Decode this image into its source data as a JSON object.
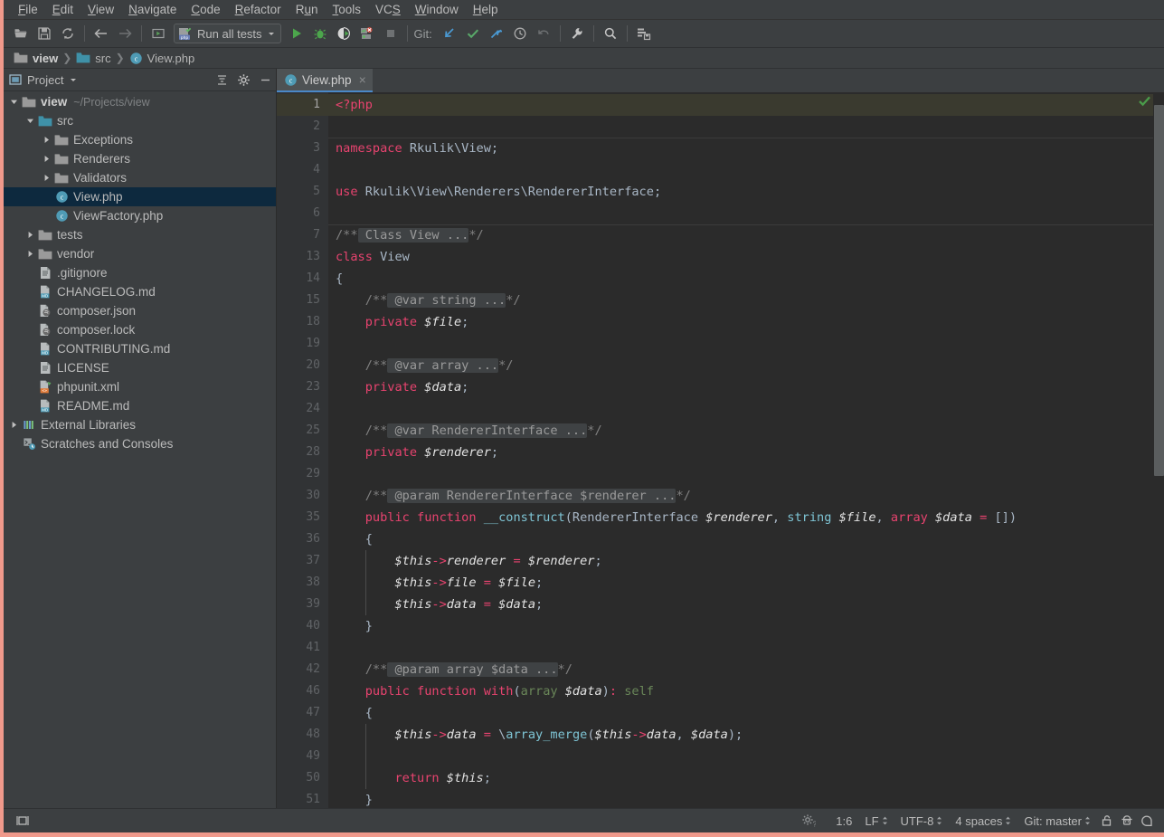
{
  "menubar": {
    "items": [
      {
        "label": "File",
        "mnemonic": "F"
      },
      {
        "label": "Edit",
        "mnemonic": "E"
      },
      {
        "label": "View",
        "mnemonic": "V"
      },
      {
        "label": "Navigate",
        "mnemonic": "N"
      },
      {
        "label": "Code",
        "mnemonic": "C"
      },
      {
        "label": "Refactor",
        "mnemonic": "R"
      },
      {
        "label": "Run",
        "mnemonic": "u"
      },
      {
        "label": "Tools",
        "mnemonic": "T"
      },
      {
        "label": "VCS",
        "mnemonic": "S"
      },
      {
        "label": "Window",
        "mnemonic": "W"
      },
      {
        "label": "Help",
        "mnemonic": "H"
      }
    ]
  },
  "toolbar": {
    "icons_left": [
      "open-folder-icon",
      "save-all-icon",
      "sync-icon"
    ],
    "nav_icons": [
      "back-icon",
      "forward-icon"
    ],
    "run_config": {
      "icon": "php-test-icon",
      "label": "Run all tests",
      "dropdown": "chevron-down-icon"
    },
    "run_icons": [
      "run-icon",
      "debug-icon",
      "run-with-coverage-icon",
      "profile-icon",
      "stop-icon"
    ],
    "git_label": "Git:",
    "git_icons": [
      "update-project-icon",
      "commit-icon",
      "push-icon",
      "history-icon",
      "rollback-icon"
    ],
    "right_icons": [
      "wrench-icon",
      "search-icon",
      "layout-icon"
    ]
  },
  "breadcrumb": {
    "items": [
      {
        "label": "view",
        "icon": "folder-icon"
      },
      {
        "label": "src",
        "icon": "folder-blue-icon"
      },
      {
        "label": "View.php",
        "icon": "php-class-icon"
      }
    ],
    "separator": "❯"
  },
  "project_panel": {
    "title": "Project",
    "dropdown_icon": "chevron-down-icon",
    "header_icons": [
      "collapse-all-icon",
      "gear-icon",
      "hide-icon"
    ],
    "tree": [
      {
        "label": "view",
        "path": "~/Projects/view",
        "icon": "folder-icon",
        "arrow": "down",
        "indent": 0,
        "bold": true,
        "selected": false
      },
      {
        "label": "src",
        "path": "",
        "icon": "folder-blue-icon",
        "arrow": "down",
        "indent": 1,
        "bold": false,
        "selected": false
      },
      {
        "label": "Exceptions",
        "path": "",
        "icon": "folder-icon",
        "arrow": "right",
        "indent": 2,
        "bold": false,
        "selected": false
      },
      {
        "label": "Renderers",
        "path": "",
        "icon": "folder-icon",
        "arrow": "right",
        "indent": 2,
        "bold": false,
        "selected": false
      },
      {
        "label": "Validators",
        "path": "",
        "icon": "folder-icon",
        "arrow": "right",
        "indent": 2,
        "bold": false,
        "selected": false
      },
      {
        "label": "View.php",
        "path": "",
        "icon": "php-class-icon",
        "arrow": "none",
        "indent": 2,
        "bold": false,
        "selected": true
      },
      {
        "label": "ViewFactory.php",
        "path": "",
        "icon": "php-class-icon",
        "arrow": "none",
        "indent": 2,
        "bold": false,
        "selected": false
      },
      {
        "label": "tests",
        "path": "",
        "icon": "folder-icon",
        "arrow": "right",
        "indent": 1,
        "bold": false,
        "selected": false
      },
      {
        "label": "vendor",
        "path": "",
        "icon": "folder-icon",
        "arrow": "right",
        "indent": 1,
        "bold": false,
        "selected": false
      },
      {
        "label": ".gitignore",
        "path": "",
        "icon": "text-file-icon",
        "arrow": "none",
        "indent": 1,
        "bold": false,
        "selected": false
      },
      {
        "label": "CHANGELOG.md",
        "path": "",
        "icon": "markdown-file-icon",
        "arrow": "none",
        "indent": 1,
        "bold": false,
        "selected": false
      },
      {
        "label": "composer.json",
        "path": "",
        "icon": "composer-file-icon",
        "arrow": "none",
        "indent": 1,
        "bold": false,
        "selected": false
      },
      {
        "label": "composer.lock",
        "path": "",
        "icon": "composer-file-icon",
        "arrow": "none",
        "indent": 1,
        "bold": false,
        "selected": false
      },
      {
        "label": "CONTRIBUTING.md",
        "path": "",
        "icon": "markdown-file-icon",
        "arrow": "none",
        "indent": 1,
        "bold": false,
        "selected": false
      },
      {
        "label": "LICENSE",
        "path": "",
        "icon": "text-file-icon",
        "arrow": "none",
        "indent": 1,
        "bold": false,
        "selected": false
      },
      {
        "label": "phpunit.xml",
        "path": "",
        "icon": "xml-file-icon",
        "arrow": "none",
        "indent": 1,
        "bold": false,
        "selected": false
      },
      {
        "label": "README.md",
        "path": "",
        "icon": "markdown-file-icon",
        "arrow": "none",
        "indent": 1,
        "bold": false,
        "selected": false
      },
      {
        "label": "External Libraries",
        "path": "",
        "icon": "libraries-icon",
        "arrow": "right",
        "indent": 0,
        "bold": false,
        "selected": false
      },
      {
        "label": "Scratches and Consoles",
        "path": "",
        "icon": "scratches-icon",
        "arrow": "none",
        "indent": 0,
        "bold": false,
        "selected": false
      }
    ]
  },
  "editor": {
    "tabs": [
      {
        "label": "View.php",
        "icon": "php-class-icon",
        "close": "×",
        "active": true
      }
    ],
    "inspection_status": "ok-check-icon",
    "lines": [
      {
        "num": "1",
        "current": true,
        "tokens": [
          {
            "t": "<?php",
            "c": "kwp"
          }
        ]
      },
      {
        "num": "2",
        "current": false,
        "tokens": []
      },
      {
        "num": "3",
        "current": false,
        "sep": true,
        "tokens": [
          {
            "t": "namespace",
            "c": "kwp"
          },
          {
            "t": " Rkulik\\View",
            "c": "typ"
          },
          {
            "t": ";",
            "c": "punc"
          }
        ]
      },
      {
        "num": "4",
        "current": false,
        "tokens": []
      },
      {
        "num": "5",
        "current": false,
        "tokens": [
          {
            "t": "use",
            "c": "kwp"
          },
          {
            "t": " Rkulik\\View\\Renderers\\RendererInterface",
            "c": "typ"
          },
          {
            "t": ";",
            "c": "punc"
          }
        ]
      },
      {
        "num": "6",
        "current": false,
        "tokens": []
      },
      {
        "num": "7",
        "current": false,
        "sep": true,
        "tokens": [
          {
            "t": "/**",
            "c": "cmt"
          },
          {
            "t": " Class View ...",
            "c": "fold"
          },
          {
            "t": "*/",
            "c": "cmt"
          }
        ]
      },
      {
        "num": "13",
        "current": false,
        "tokens": [
          {
            "t": "class",
            "c": "kwp"
          },
          {
            "t": " View",
            "c": "typ"
          }
        ]
      },
      {
        "num": "14",
        "current": false,
        "tokens": [
          {
            "t": "{",
            "c": "punc"
          }
        ]
      },
      {
        "num": "15",
        "current": false,
        "tokens": [
          {
            "t": "    /**",
            "c": "cmt"
          },
          {
            "t": " @var string ...",
            "c": "fold"
          },
          {
            "t": "*/",
            "c": "cmt"
          }
        ]
      },
      {
        "num": "18",
        "current": false,
        "tokens": [
          {
            "t": "    ",
            "c": "punc"
          },
          {
            "t": "private",
            "c": "kwp"
          },
          {
            "t": " ",
            "c": "punc"
          },
          {
            "t": "$file",
            "c": "varw"
          },
          {
            "t": ";",
            "c": "punc"
          }
        ]
      },
      {
        "num": "19",
        "current": false,
        "tokens": []
      },
      {
        "num": "20",
        "current": false,
        "tokens": [
          {
            "t": "    /**",
            "c": "cmt"
          },
          {
            "t": " @var array ...",
            "c": "fold"
          },
          {
            "t": "*/",
            "c": "cmt"
          }
        ]
      },
      {
        "num": "23",
        "current": false,
        "tokens": [
          {
            "t": "    ",
            "c": "punc"
          },
          {
            "t": "private",
            "c": "kwp"
          },
          {
            "t": " ",
            "c": "punc"
          },
          {
            "t": "$data",
            "c": "varw"
          },
          {
            "t": ";",
            "c": "punc"
          }
        ]
      },
      {
        "num": "24",
        "current": false,
        "tokens": []
      },
      {
        "num": "25",
        "current": false,
        "tokens": [
          {
            "t": "    /**",
            "c": "cmt"
          },
          {
            "t": " @var RendererInterface ...",
            "c": "fold"
          },
          {
            "t": "*/",
            "c": "cmt"
          }
        ]
      },
      {
        "num": "28",
        "current": false,
        "tokens": [
          {
            "t": "    ",
            "c": "punc"
          },
          {
            "t": "private",
            "c": "kwp"
          },
          {
            "t": " ",
            "c": "punc"
          },
          {
            "t": "$renderer",
            "c": "varw"
          },
          {
            "t": ";",
            "c": "punc"
          }
        ]
      },
      {
        "num": "29",
        "current": false,
        "tokens": []
      },
      {
        "num": "30",
        "current": false,
        "tokens": [
          {
            "t": "    /**",
            "c": "cmt"
          },
          {
            "t": " @param RendererInterface $renderer ...",
            "c": "fold"
          },
          {
            "t": "*/",
            "c": "cmt"
          }
        ]
      },
      {
        "num": "35",
        "current": false,
        "tokens": [
          {
            "t": "    ",
            "c": "punc"
          },
          {
            "t": "public function",
            "c": "kwp"
          },
          {
            "t": " ",
            "c": "punc"
          },
          {
            "t": "__construct",
            "c": "fnc"
          },
          {
            "t": "(",
            "c": "punc"
          },
          {
            "t": "RendererInterface",
            "c": "typ"
          },
          {
            "t": " ",
            "c": "punc"
          },
          {
            "t": "$renderer",
            "c": "varw"
          },
          {
            "t": ", ",
            "c": "punc"
          },
          {
            "t": "string",
            "c": "fnc"
          },
          {
            "t": " ",
            "c": "punc"
          },
          {
            "t": "$file",
            "c": "varw"
          },
          {
            "t": ", ",
            "c": "punc"
          },
          {
            "t": "array",
            "c": "kwp"
          },
          {
            "t": " ",
            "c": "punc"
          },
          {
            "t": "$data",
            "c": "varw"
          },
          {
            "t": " ",
            "c": "punc"
          },
          {
            "t": "=",
            "c": "arrow"
          },
          {
            "t": " [])",
            "c": "punc"
          }
        ]
      },
      {
        "num": "36",
        "current": false,
        "tokens": [
          {
            "t": "    {",
            "c": "punc"
          }
        ]
      },
      {
        "num": "37",
        "current": false,
        "tokens": [
          {
            "t": "        ",
            "c": "punc"
          },
          {
            "t": "$this",
            "c": "varw"
          },
          {
            "t": "->",
            "c": "arrow"
          },
          {
            "t": "renderer",
            "c": "varw"
          },
          {
            "t": " ",
            "c": "punc"
          },
          {
            "t": "=",
            "c": "arrow"
          },
          {
            "t": " ",
            "c": "punc"
          },
          {
            "t": "$renderer",
            "c": "varw"
          },
          {
            "t": ";",
            "c": "punc"
          }
        ]
      },
      {
        "num": "38",
        "current": false,
        "tokens": [
          {
            "t": "        ",
            "c": "punc"
          },
          {
            "t": "$this",
            "c": "varw"
          },
          {
            "t": "->",
            "c": "arrow"
          },
          {
            "t": "file",
            "c": "varw"
          },
          {
            "t": " ",
            "c": "punc"
          },
          {
            "t": "=",
            "c": "arrow"
          },
          {
            "t": " ",
            "c": "punc"
          },
          {
            "t": "$file",
            "c": "varw"
          },
          {
            "t": ";",
            "c": "punc"
          }
        ]
      },
      {
        "num": "39",
        "current": false,
        "tokens": [
          {
            "t": "        ",
            "c": "punc"
          },
          {
            "t": "$this",
            "c": "varw"
          },
          {
            "t": "->",
            "c": "arrow"
          },
          {
            "t": "data",
            "c": "varw"
          },
          {
            "t": " ",
            "c": "punc"
          },
          {
            "t": "=",
            "c": "arrow"
          },
          {
            "t": " ",
            "c": "punc"
          },
          {
            "t": "$data",
            "c": "varw"
          },
          {
            "t": ";",
            "c": "punc"
          }
        ]
      },
      {
        "num": "40",
        "current": false,
        "tokens": [
          {
            "t": "    }",
            "c": "punc"
          }
        ]
      },
      {
        "num": "41",
        "current": false,
        "tokens": []
      },
      {
        "num": "42",
        "current": false,
        "tokens": [
          {
            "t": "    /**",
            "c": "cmt"
          },
          {
            "t": " @param array $data ...",
            "c": "fold"
          },
          {
            "t": "*/",
            "c": "cmt"
          }
        ]
      },
      {
        "num": "46",
        "current": false,
        "tokens": [
          {
            "t": "    ",
            "c": "punc"
          },
          {
            "t": "public function",
            "c": "kwp"
          },
          {
            "t": " ",
            "c": "punc"
          },
          {
            "t": "with",
            "c": "kwp"
          },
          {
            "t": "(",
            "c": "punc"
          },
          {
            "t": "array",
            "c": "str"
          },
          {
            "t": " ",
            "c": "punc"
          },
          {
            "t": "$data",
            "c": "varw"
          },
          {
            "t": ")",
            "c": "punc"
          },
          {
            "t": ":",
            "c": "arrow"
          },
          {
            "t": " ",
            "c": "punc"
          },
          {
            "t": "self",
            "c": "str"
          }
        ]
      },
      {
        "num": "47",
        "current": false,
        "tokens": [
          {
            "t": "    {",
            "c": "punc"
          }
        ]
      },
      {
        "num": "48",
        "current": false,
        "tokens": [
          {
            "t": "        ",
            "c": "punc"
          },
          {
            "t": "$this",
            "c": "varw"
          },
          {
            "t": "->",
            "c": "arrow"
          },
          {
            "t": "data",
            "c": "varw"
          },
          {
            "t": " ",
            "c": "punc"
          },
          {
            "t": "=",
            "c": "arrow"
          },
          {
            "t": " \\",
            "c": "punc"
          },
          {
            "t": "array_merge",
            "c": "fnc"
          },
          {
            "t": "(",
            "c": "punc"
          },
          {
            "t": "$this",
            "c": "varw"
          },
          {
            "t": "->",
            "c": "arrow"
          },
          {
            "t": "data",
            "c": "varw"
          },
          {
            "t": ", ",
            "c": "punc"
          },
          {
            "t": "$data",
            "c": "varw"
          },
          {
            "t": ");",
            "c": "punc"
          }
        ]
      },
      {
        "num": "49",
        "current": false,
        "tokens": []
      },
      {
        "num": "50",
        "current": false,
        "tokens": [
          {
            "t": "        ",
            "c": "punc"
          },
          {
            "t": "return",
            "c": "kwp"
          },
          {
            "t": " ",
            "c": "punc"
          },
          {
            "t": "$this",
            "c": "varw"
          },
          {
            "t": ";",
            "c": "punc"
          }
        ]
      },
      {
        "num": "51",
        "current": false,
        "tokens": [
          {
            "t": "    }",
            "c": "punc"
          }
        ]
      }
    ]
  },
  "statusbar": {
    "left_icon": "toggle-toolwindow-icon",
    "items": [
      {
        "name": "inspection-icon",
        "label": "",
        "icon": "inspection-gear-icon"
      },
      {
        "name": "caret-position",
        "label": "1:6",
        "chevron": false
      },
      {
        "name": "line-separator",
        "label": "LF",
        "chevron": true
      },
      {
        "name": "file-encoding",
        "label": "UTF-8",
        "chevron": true
      },
      {
        "name": "indent-size",
        "label": "4 spaces",
        "chevron": true
      },
      {
        "name": "git-branch",
        "label": "Git: master",
        "chevron": true
      }
    ],
    "right_icons": [
      "lock-icon",
      "hector-icon",
      "notifications-icon"
    ]
  },
  "colors": {
    "chrome": "#3c3f41",
    "editor_bg": "#2b2b2b",
    "gutter_bg": "#313335",
    "selection": "#0d293e",
    "tab_active": "#4e5254",
    "tab_underline": "#4a88c7",
    "accent_border": "#f0998b",
    "keyword": "#e8436f",
    "comment": "#808080",
    "fold_bg": "#3f4244",
    "string": "#6a8759",
    "function": "#7ec4d4",
    "current_line": "#3a3a2f",
    "ok_green": "#4a9c4a"
  }
}
